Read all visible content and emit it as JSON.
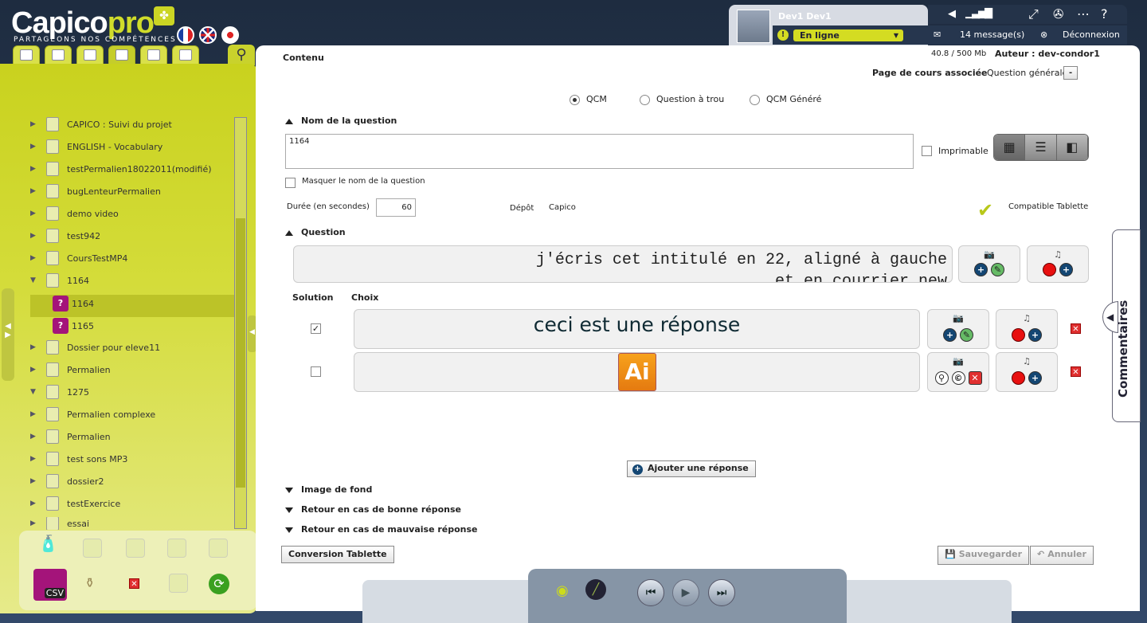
{
  "app": {
    "brand_main": "Capico",
    "brand_pro": "pro",
    "tagline": "PARTAGEONS NOS COMPÉTENCES"
  },
  "user": {
    "name": "Dev1 Dev1",
    "status": "En ligne",
    "messages": "14 message(s)",
    "logout": "Déconnexion"
  },
  "tree": {
    "items": [
      {
        "label": "CAPICO : Suivi du projet"
      },
      {
        "label": "ENGLISH - Vocabulary"
      },
      {
        "label": "testPermalien18022011(modifié)"
      },
      {
        "label": "bugLenteurPermalien"
      },
      {
        "label": "demo video"
      },
      {
        "label": "test942"
      },
      {
        "label": "CoursTestMP4"
      },
      {
        "label": "1164"
      },
      {
        "label": "1164"
      },
      {
        "label": "1165"
      },
      {
        "label": "Dossier pour eleve11"
      },
      {
        "label": "Permalien"
      },
      {
        "label": "1275"
      },
      {
        "label": "Permalien complexe"
      },
      {
        "label": "Permalien"
      },
      {
        "label": "test sons MP3"
      },
      {
        "label": "dossier2"
      },
      {
        "label": "testExercice"
      },
      {
        "label": "essai"
      }
    ],
    "csv_label": "CSV"
  },
  "content": {
    "header": "Contenu",
    "storage": "40.8 / 500 Mb",
    "author": "Auteur : dev-condor1",
    "linked_page_label": "Page de cours associée",
    "linked_page_value": "Question générale",
    "linked_page_btn": "-",
    "types": [
      "QCM",
      "Question à trou",
      "QCM Généré"
    ],
    "name_section": "Nom de la question",
    "name_value": "1164",
    "printable": "Imprimable",
    "hide_name": "Masquer le nom de la question",
    "duration_label": "Durée (en secondes)",
    "duration_value": "60",
    "depot_label": "Dépôt",
    "depot_value": "Capico",
    "tablet_compat": "Compatible Tablette",
    "question_section": "Question",
    "question_text_line1": "j'écris cet intitulé en 22, aligné à gauche",
    "question_text_line2": "et en courrier new",
    "col_solution": "Solution",
    "col_choix": "Choix",
    "answer1": "ceci est une réponse",
    "answer2_icon": "Ai",
    "add_answer": "Ajouter une réponse",
    "bg_image": "Image de fond",
    "good_feedback": "Retour en cas de bonne réponse",
    "bad_feedback": "Retour en cas de mauvaise réponse",
    "convert": "Conversion Tablette",
    "save": "Sauvegarder",
    "cancel": "Annuler",
    "comments": "Commentaires"
  },
  "colors": {
    "accent": "#d4dc22",
    "answer_text": "#0f2a33",
    "tablet_green": "#2a9a10"
  }
}
